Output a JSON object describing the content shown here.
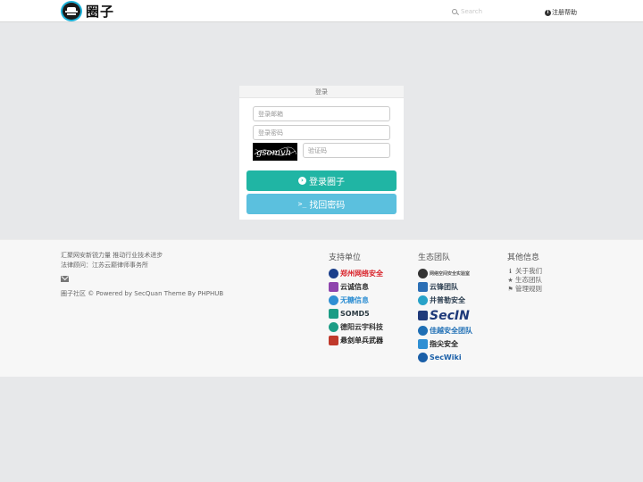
{
  "header": {
    "logo_text": "圈子",
    "search": {
      "placeholder": "Search"
    },
    "help_label": "注册帮助"
  },
  "login": {
    "heading": "登录",
    "email_placeholder": "登录邮箱",
    "password_placeholder": "登录密码",
    "captcha_text": "gsomvh",
    "captcha_placeholder": "验证码",
    "login_button": "登录圈子",
    "find_password_button": "找回密码"
  },
  "footer": {
    "slogan": "汇聚网安新锐力量 推动行业技术进步",
    "legal": "法律顾问：江苏云巅律师事务所",
    "copyright": "圈子社区 © Powered by SecQuan Theme By PHPHUB",
    "sponsors_title": "支持单位",
    "sponsors": [
      {
        "name": "郑州网络安全",
        "color": "#d9232b",
        "mark": "#1b3f8b"
      },
      {
        "name": "云诚信息",
        "color": "#2c2c2c",
        "mark": "#8e44ad"
      },
      {
        "name": "无糖信息",
        "color": "#2f8fd3",
        "mark": "#2f8fd3"
      },
      {
        "name": "SOMD5",
        "color": "#2b3a42",
        "mark": "#1b9c85"
      },
      {
        "name": "德阳云宇科技",
        "color": "#333333",
        "mark": "#1b9c85"
      },
      {
        "name": "悬剑单兵武器",
        "color": "#222222",
        "mark": "#c0392b"
      }
    ],
    "ecosystem_title": "生态团队",
    "ecosystem": [
      {
        "name": "网络空间安全实验室",
        "color": "#555555",
        "mark": "#333333",
        "style": "tiny"
      },
      {
        "name": "云锋团队",
        "color": "#2c3e50",
        "mark": "#2c6fb5",
        "style": "normal"
      },
      {
        "name": "井普勒安全",
        "color": "#2c3e50",
        "mark": "#27a2c8",
        "style": "normal"
      },
      {
        "name": "SecIN",
        "color": "#1f3a7a",
        "mark": "#1f3a7a",
        "style": "big"
      },
      {
        "name": "佳越安全团队",
        "color": "#1f6fb5",
        "mark": "#1f6fb5",
        "style": "normal"
      },
      {
        "name": "指尖安全",
        "color": "#222222",
        "mark": "#2f8fd3",
        "style": "normal"
      },
      {
        "name": "SecWiki",
        "color": "#1a5fa8",
        "mark": "#1a5fa8",
        "style": "normal"
      }
    ],
    "other_title": "其他信息",
    "other_links": [
      {
        "label": "关于我们",
        "icon": "info-circle-icon",
        "glyph": "ℹ"
      },
      {
        "label": "生态团队",
        "icon": "star-icon",
        "glyph": "★"
      },
      {
        "label": "管理规则",
        "icon": "flag-icon",
        "glyph": "⚑"
      }
    ]
  },
  "colors": {
    "primary_button": "#20b5a4",
    "secondary_button": "#5bc0de",
    "logo_ring": "#1cb1d8"
  }
}
